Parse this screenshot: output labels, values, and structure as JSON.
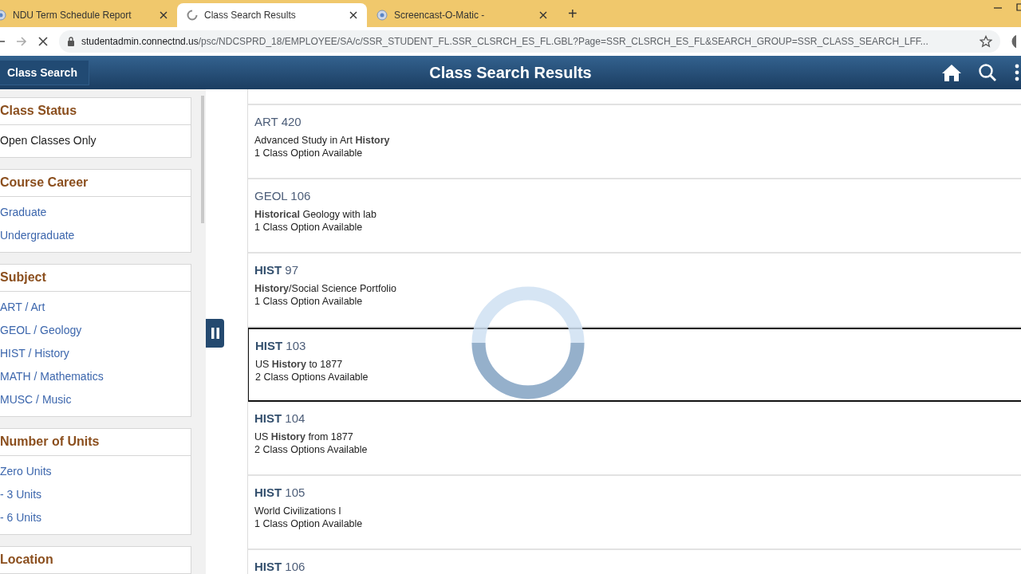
{
  "browser": {
    "tabs": [
      {
        "title": "NDU Term Schedule Report",
        "selected": false,
        "loading": false
      },
      {
        "title": "Class Search Results",
        "selected": true,
        "loading": true
      },
      {
        "title": "Screencast-O-Matic -",
        "selected": false,
        "loading": false
      }
    ],
    "new_tab": "+",
    "url_host": "studentadmin.connectnd.us",
    "url_path": "/psc/NDCSPRD_18/EMPLOYEE/SA/c/SSR_STUDENT_FL.SSR_CLSRCH_ES_FL.GBL?Page=SSR_CLSRCH_ES_FL&SEARCH_GROUP=SSR_CLASS_SEARCH_LFF...",
    "page_loading": true
  },
  "header": {
    "back_button": "Class Search",
    "title": "Class Search Results"
  },
  "filters": [
    {
      "title": "Class Status",
      "items": [
        {
          "label": "Open Classes Only",
          "kind": "text"
        }
      ]
    },
    {
      "title": "Course Career",
      "items": [
        {
          "label": "Graduate",
          "kind": "link"
        },
        {
          "label": "Undergraduate",
          "kind": "link"
        }
      ]
    },
    {
      "title": "Subject",
      "items": [
        {
          "label": "ART / Art",
          "kind": "link"
        },
        {
          "label": "GEOL / Geology",
          "kind": "link"
        },
        {
          "label": "HIST / History",
          "kind": "link"
        },
        {
          "label": "MATH / Mathematics",
          "kind": "link"
        },
        {
          "label": "MUSC / Music",
          "kind": "link"
        }
      ]
    },
    {
      "title": "Number of Units",
      "items": [
        {
          "label": "Zero Units",
          "kind": "link"
        },
        {
          "label": "- 3 Units",
          "kind": "link"
        },
        {
          "label": "- 6 Units",
          "kind": "link"
        }
      ]
    },
    {
      "title": "Location"
    }
  ],
  "results": [
    {
      "code": "ART 420",
      "title": "Advanced Study in Art **History**",
      "options": "1 Class Option Available",
      "selected": false
    },
    {
      "code": "GEOL 106",
      "title": "**Historical** Geology with lab",
      "options": "1 Class Option Available",
      "selected": false
    },
    {
      "code": "**HIST** 97",
      "title": "**History**/Social Science Portfolio",
      "options": "1 Class Option Available",
      "selected": false
    },
    {
      "code": "**HIST** 103",
      "title": "US **History** to 1877",
      "options": "2 Class Options Available",
      "selected": true
    },
    {
      "code": "**HIST** 104",
      "title": "US **History** from 1877",
      "options": "2 Class Options Available",
      "selected": false
    },
    {
      "code": "**HIST** 105",
      "title": "World Civilizations I",
      "options": "1 Class Option Available",
      "selected": false
    },
    {
      "code": "**HIST** 106",
      "selected": false
    }
  ]
}
